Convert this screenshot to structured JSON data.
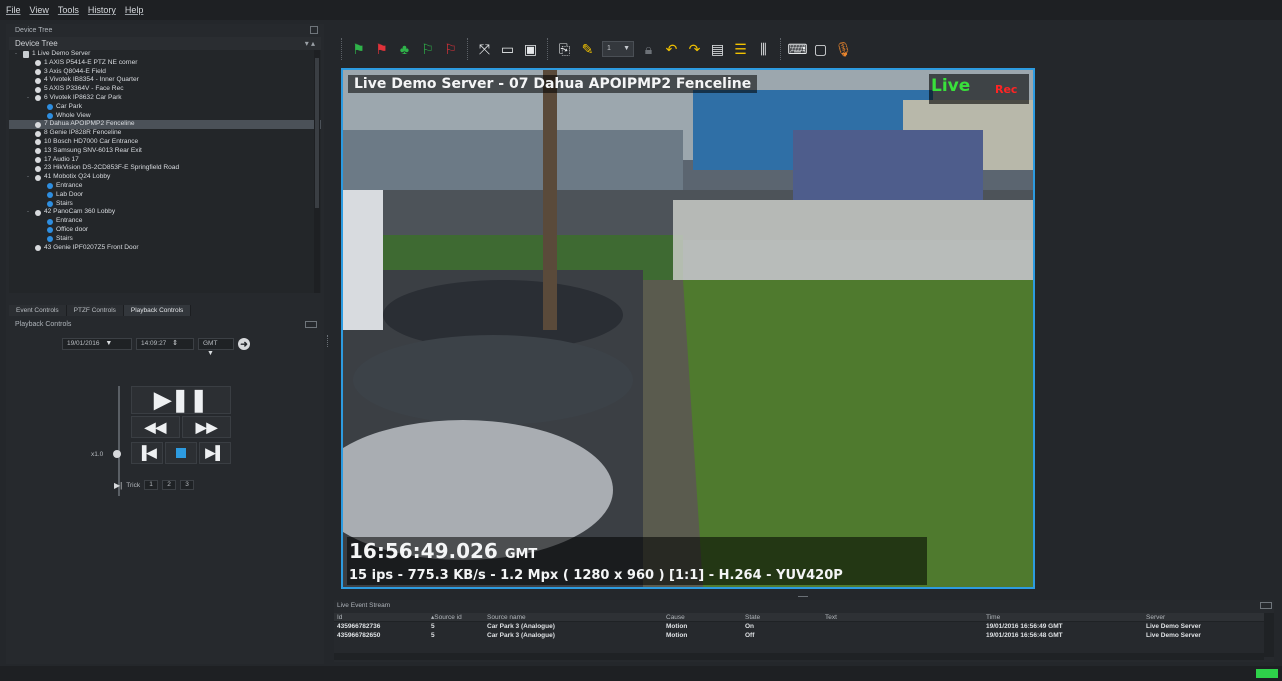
{
  "menu": [
    "File",
    "View",
    "Tools",
    "History",
    "Help"
  ],
  "device_tree": {
    "caption": "Device Tree",
    "header": "Device Tree",
    "items": [
      {
        "label": "1 Live Demo Server",
        "level": 0,
        "icon": "server-icon",
        "exp": "-"
      },
      {
        "label": "1 AXIS P5414-E PTZ NE corner",
        "level": 1,
        "icon": "camera-icon",
        "exp": ""
      },
      {
        "label": "3 Axis Q8044-E Field",
        "level": 1,
        "icon": "camera-icon",
        "exp": ""
      },
      {
        "label": "4 Vivotek IB8354 - Inner Quarter",
        "level": 1,
        "icon": "camera-icon",
        "exp": ""
      },
      {
        "label": "5 AXIS P3364V - Face Rec",
        "level": 1,
        "icon": "camera-icon",
        "exp": ""
      },
      {
        "label": "6 Vivotek IP8632 Car Park",
        "level": 1,
        "icon": "camera-icon",
        "exp": "-"
      },
      {
        "label": "Car Park",
        "level": 2,
        "icon": "view-icon",
        "exp": ""
      },
      {
        "label": "Whole View",
        "level": 2,
        "icon": "view-icon",
        "exp": ""
      },
      {
        "label": "7 Dahua APOIPMP2 Fenceline",
        "level": 1,
        "icon": "camera-icon",
        "exp": "",
        "selected": true
      },
      {
        "label": "8 Genie IP828R Fenceline",
        "level": 1,
        "icon": "camera-icon",
        "exp": ""
      },
      {
        "label": "10 Bosch HD7000 Car Entrance",
        "level": 1,
        "icon": "camera-icon",
        "exp": ""
      },
      {
        "label": "13 Samsung SNV-6013 Rear Exit",
        "level": 1,
        "icon": "camera-icon",
        "exp": ""
      },
      {
        "label": "17 Audio 17",
        "level": 1,
        "icon": "microphone-icon",
        "exp": ""
      },
      {
        "label": "23 HikVision DS-2CD853F-E Springfield Road",
        "level": 1,
        "icon": "camera-icon",
        "exp": ""
      },
      {
        "label": "41 Mobotix Q24 Lobby",
        "level": 1,
        "icon": "camera-icon",
        "exp": "-"
      },
      {
        "label": "Entrance",
        "level": 2,
        "icon": "view-icon",
        "exp": ""
      },
      {
        "label": "Lab Door",
        "level": 2,
        "icon": "view-icon",
        "exp": ""
      },
      {
        "label": "Stairs",
        "level": 2,
        "icon": "view-icon",
        "exp": ""
      },
      {
        "label": "42 PanoCam 360 Lobby",
        "level": 1,
        "icon": "camera-icon",
        "exp": "-"
      },
      {
        "label": "Entrance",
        "level": 2,
        "icon": "view-icon",
        "exp": ""
      },
      {
        "label": "Office door",
        "level": 2,
        "icon": "view-icon",
        "exp": ""
      },
      {
        "label": "Stairs",
        "level": 2,
        "icon": "view-icon",
        "exp": ""
      },
      {
        "label": "43 Genie IPF0207Z5 Front Door",
        "level": 1,
        "icon": "camera-icon",
        "exp": ""
      }
    ]
  },
  "tabs": [
    "Event Controls",
    "PTZF Controls",
    "Playback Controls"
  ],
  "playback": {
    "caption": "Playback Controls",
    "date": "19/01/2016",
    "time": "14:09:27",
    "timezone": "GMT",
    "speed": "x1.0",
    "trick_label": "Trick",
    "trick_values": [
      "1",
      "2",
      "3"
    ]
  },
  "video": {
    "title": "Live Demo Server - 07 Dahua APOIPMP2 Fenceline",
    "live_label": "Live",
    "rec_label": "Rec",
    "timestamp": "16:56:49.026",
    "timezone": "GMT",
    "stats": "15 ips  -  775.3 KB/s  -  1.2 Mpx  ( 1280 x 960 ) [1:1] -  H.264  -  YUV420P"
  },
  "toolbar": {
    "zoom_value": "1"
  },
  "event_stream": {
    "caption": "Live Event Stream",
    "columns": {
      "id": "Id",
      "source_id": "Source id",
      "source_name": "Source name",
      "cause": "Cause",
      "state": "State",
      "text": "Text",
      "time": "Time",
      "server": "Server"
    },
    "rows": [
      {
        "id": "435966782736",
        "source_id": "5",
        "source_name": "Car Park 3 (Analogue)",
        "cause": "Motion",
        "state": "On",
        "text": "",
        "time": "19/01/2016 16:56:49 GMT",
        "server": "Live Demo Server"
      },
      {
        "id": "435966782650",
        "source_id": "5",
        "source_name": "Car Park 3 (Analogue)",
        "cause": "Motion",
        "state": "Off",
        "text": "",
        "time": "19/01/2016 16:56:48 GMT",
        "server": "Live Demo Server"
      }
    ]
  },
  "colors": {
    "accent": "#2d9be0",
    "live": "#39e13b",
    "rec": "#ff2424",
    "status_ok": "#2ed24a"
  }
}
